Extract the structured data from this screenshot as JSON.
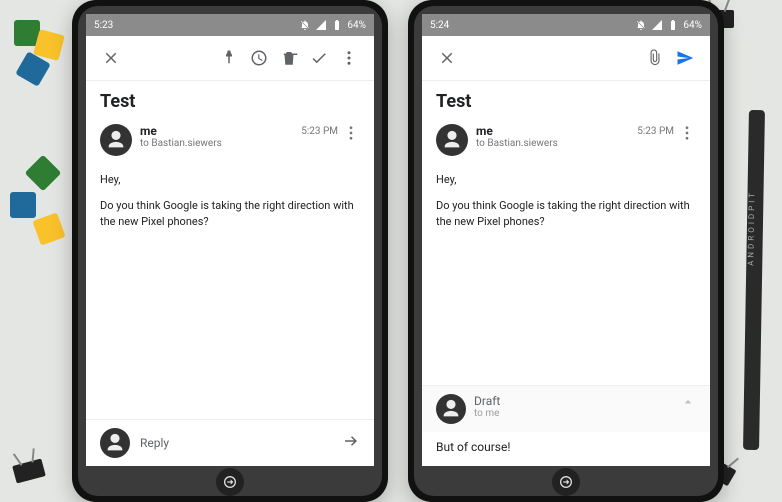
{
  "statusbar": {
    "time_left": "5:23",
    "time_right": "5:24",
    "battery": "64%"
  },
  "left": {
    "appbar": {
      "icons": [
        "close",
        "pin",
        "clock",
        "delete",
        "done",
        "overflow"
      ]
    },
    "subject": "Test",
    "message": {
      "sender": "me",
      "recipient": "to Bastian.siewers",
      "time": "5:23 PM",
      "body_line1": "Hey,",
      "body_line2": "Do you think Google is taking the right direction with the new Pixel phones?"
    },
    "reply": {
      "label": "Reply"
    }
  },
  "right": {
    "appbar": {
      "icons": [
        "close",
        "attach",
        "send"
      ]
    },
    "subject": "Test",
    "message": {
      "sender": "me",
      "recipient": "to Bastian.siewers",
      "time": "5:23 PM",
      "body_line1": "Hey,",
      "body_line2": "Do you think Google is taking the right direction with the new Pixel phones?"
    },
    "draft": {
      "title": "Draft",
      "recipient": "to me",
      "text": "But of course!"
    }
  }
}
